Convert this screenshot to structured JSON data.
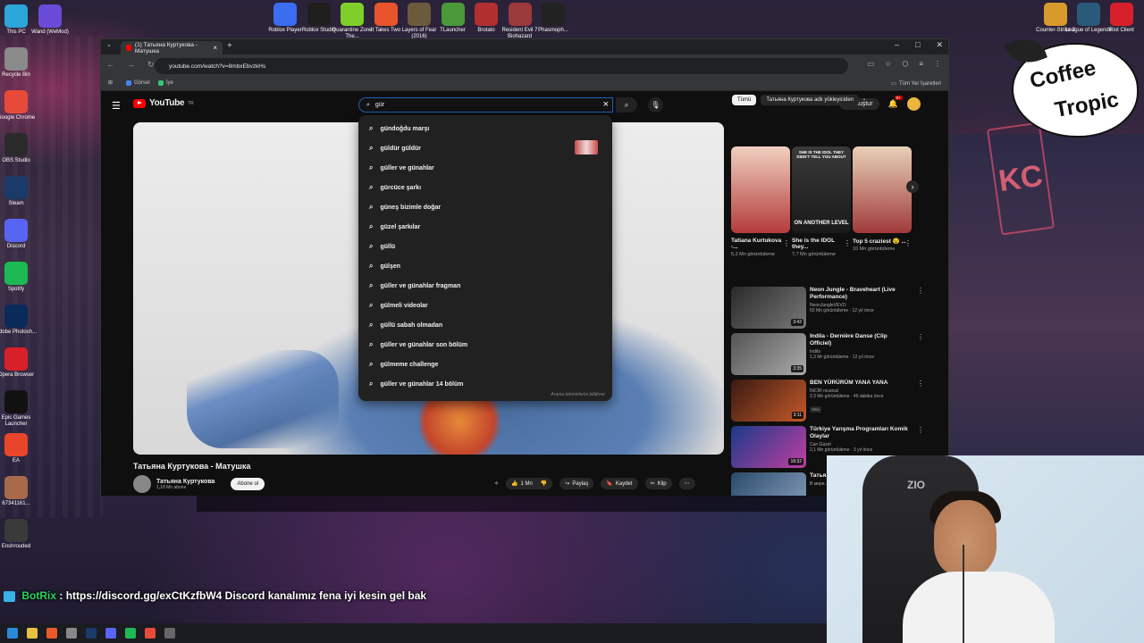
{
  "desktop": {
    "top_icons": [
      {
        "label": "Roblox Player",
        "color": "#3a6df0"
      },
      {
        "label": "Roblox Studio",
        "color": "#1f1f1f"
      },
      {
        "label": "Quarantine Zone The...",
        "color": "#7fcf2a"
      },
      {
        "label": "It Takes Two",
        "color": "#e8542c"
      },
      {
        "label": "Layers of Fear (2016)",
        "color": "#6b5a3c"
      },
      {
        "label": "TLauncher",
        "color": "#4a9a3a"
      },
      {
        "label": "Brotato",
        "color": "#b03030"
      },
      {
        "label": "Resident Evil 7 Biohazard",
        "color": "#9a3a3a"
      },
      {
        "label": "Phasmoph...",
        "color": "#222"
      }
    ],
    "left_icons": [
      {
        "label": "This PC",
        "color": "#2aa6d8"
      },
      {
        "label": "Wand (WeMod)",
        "color": "#6a4bd8"
      },
      {
        "label": "Recycle Bin",
        "color": "#8a8a8a"
      },
      {
        "label": "Google Chrome",
        "color": "#e84a3a"
      },
      {
        "label": "OBS Studio",
        "color": "#2a2a2a"
      },
      {
        "label": "Steam",
        "color": "#1a3a6a"
      },
      {
        "label": "Discord",
        "color": "#5865f2"
      },
      {
        "label": "Spotify",
        "color": "#1db954"
      },
      {
        "label": "Adobe Photosh...",
        "color": "#0a2a5a"
      },
      {
        "label": "Opera Browser",
        "color": "#d8202a"
      },
      {
        "label": "Epic Games Launcher",
        "color": "#111"
      },
      {
        "label": "EA",
        "color": "#e8452a"
      },
      {
        "label": "67341161...",
        "color": "#a86a4a"
      },
      {
        "label": "Enshrouded",
        "color": "#3a3a3a"
      }
    ],
    "right_icons": [
      {
        "label": "Counter-Strike 2",
        "color": "#d89a2a"
      },
      {
        "label": "League of Legends",
        "color": "#2a5a7a"
      },
      {
        "label": "Riot Client",
        "color": "#d8202a"
      }
    ]
  },
  "browser": {
    "tab_title": "(1) Татьяна Куртукова - Матушка",
    "url": "youtube.com/watch?v=8mbxEbvzkHs",
    "bookmarks": [
      "Görsel",
      "İye"
    ],
    "all_bookmarks": "Tüm Yer İşaretleri"
  },
  "youtube": {
    "logo": "YouTube",
    "logo_region": "TR",
    "search_query": "gür",
    "create_label": "Oluştur",
    "notif_count": "9+",
    "suggestions": [
      "gündoğdu marşı",
      "güldür güldür",
      "güller ve günahlar",
      "gürcüce şarkı",
      "güneş bizimle doğar",
      "güzel şarkılar",
      "güllü",
      "gülşen",
      "güller ve günahlar fragman",
      "gülmeli videolar",
      "güllü sabah olmadan",
      "güller ve günahlar son bölüm",
      "gülmeme challenge",
      "güller ve günahlar 14 bölüm"
    ],
    "suggest_footer": "Arama tahminlerini bildirme",
    "video": {
      "title": "Татьяна Куртукова - Матушка",
      "channel": "Татьяна Куртукова",
      "subs": "1,18 Mn abone",
      "subscribe": "Abone ol",
      "likes": "1 Mn",
      "share": "Paylaş",
      "save": "Kaydet",
      "clip": "Klip"
    },
    "chips": [
      "Tümü",
      "Татьяна Куртукова adlı yükleyiciden"
    ],
    "shorts": [
      {
        "title": "Tatiana Kurtukova -...",
        "views": "5,2 Mn görüntüleme",
        "color1": "#b43b3b",
        "color2": "#f0d0c0"
      },
      {
        "title": "She is the IDOL they...",
        "views": "7,7 Mn görüntüleme",
        "color1": "#1a1a1a",
        "color2": "#3a3a3a",
        "overlay_top": "SHE IS THE IDOL THEY DIDN'T TELL YOU ABOUT",
        "overlay_bottom": "ON ANOTHER LEVEL"
      },
      {
        "title": "Top 5 craziest 😵 ...",
        "views": "10 Mn görüntüleme",
        "color1": "#a03a3a",
        "color2": "#e8d0b8"
      }
    ],
    "recommendations": [
      {
        "title": "Neon Jungle - Braveheart (Live Performance)",
        "channel": "NeonJungleVEVO",
        "meta": "60 Mn görüntüleme · 12 yıl önce",
        "duration": "3:42",
        "color1": "#2a2a2a",
        "color2": "#777"
      },
      {
        "title": "Indila - Dernière Danse (Clip Officiel)",
        "channel": "Indila",
        "meta": "1,3 Mr görüntüleme · 12 yıl önce",
        "duration": "3:35",
        "color1": "#555",
        "color2": "#aaa"
      },
      {
        "title": "BEN YÜRÜRÜM YANA YANA",
        "channel": "İNCİR musical",
        "meta": "2,3 Mn görüntüleme · 46 dakika önce",
        "duration": "3:11",
        "badge": "Yeni",
        "color1": "#3a1a12",
        "color2": "#c45a2a"
      },
      {
        "title": "Türkiye Yarışma Programları Komik Olaylar",
        "channel": "Can Güzel",
        "meta": "2,1 Mn görüntüleme · 3 yıl önce",
        "duration": "18:32",
        "color1": "#1a3a8a",
        "color2": "#c040a0"
      },
      {
        "title": "Татья... Песня...",
        "channel": "В мире...",
        "meta": "",
        "duration": "",
        "color1": "#2a4a6a",
        "color2": "#8aa0c0"
      }
    ]
  },
  "overlay": {
    "chat_user": "BotRix",
    "chat_text": ": https://discord.gg/exCtKzfbW4 Discord kanalımız fena iyi kesin gel bak"
  },
  "brand": {
    "logo_line1": "Coffee",
    "logo_line2": "Tropic",
    "chair_logo": "ZIO"
  }
}
